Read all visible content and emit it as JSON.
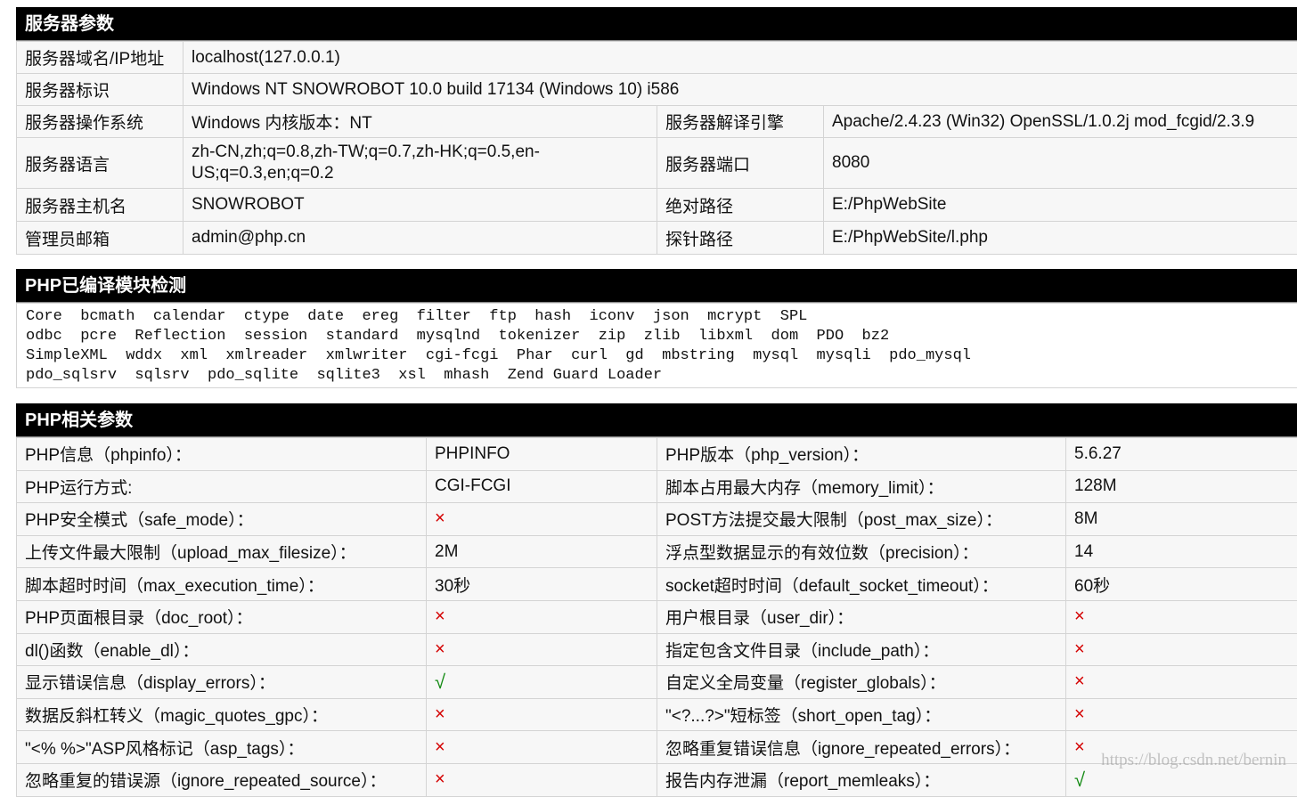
{
  "server_section": {
    "title": "服务器参数",
    "rows": [
      {
        "l1": "服务器域名/IP地址",
        "v1": "localhost(127.0.0.1)"
      },
      {
        "l1": "服务器标识",
        "v1": "Windows NT SNOWROBOT 10.0 build 17134 (Windows 10) i586"
      },
      {
        "l1": "服务器操作系统",
        "v1": "Windows  内核版本：NT",
        "l2": "服务器解译引擎",
        "v2": "Apache/2.4.23 (Win32) OpenSSL/1.0.2j mod_fcgid/2.3.9"
      },
      {
        "l1": "服务器语言",
        "v1": "zh-CN,zh;q=0.8,zh-TW;q=0.7,zh-HK;q=0.5,en-US;q=0.3,en;q=0.2",
        "l2": "服务器端口",
        "v2": "8080"
      },
      {
        "l1": "服务器主机名",
        "v1": "SNOWROBOT",
        "l2": "绝对路径",
        "v2": "E:/PhpWebSite"
      },
      {
        "l1": "管理员邮箱",
        "v1": "admin@php.cn",
        "l2": "探针路径",
        "v2": "E:/PhpWebSite/l.php"
      }
    ]
  },
  "modules_section": {
    "title": "PHP已编译模块检测",
    "lines": [
      "Core  bcmath  calendar  ctype  date  ereg  filter  ftp  hash  iconv  json  mcrypt  SPL",
      "odbc  pcre  Reflection  session  standard  mysqlnd  tokenizer  zip  zlib  libxml  dom  PDO  bz2",
      "SimpleXML  wddx  xml  xmlreader  xmlwriter  cgi-fcgi  Phar  curl  gd  mbstring  mysql  mysqli  pdo_mysql",
      "pdo_sqlsrv  sqlsrv  pdo_sqlite  sqlite3  xsl  mhash  Zend Guard Loader"
    ]
  },
  "php_section": {
    "title": "PHP相关参数",
    "rows": [
      {
        "l1": "PHP信息（phpinfo）：",
        "v1": "PHPINFO",
        "l2": "PHP版本（php_version）：",
        "v2": "5.6.27"
      },
      {
        "l1": "PHP运行方式:",
        "v1": "CGI-FCGI",
        "l2": "脚本占用最大内存（memory_limit）：",
        "v2": "128M"
      },
      {
        "l1": "PHP安全模式（safe_mode）：",
        "v1": "×",
        "l2": "POST方法提交最大限制（post_max_size）：",
        "v2": "8M"
      },
      {
        "l1": "上传文件最大限制（upload_max_filesize）：",
        "v1": "2M",
        "l2": "浮点型数据显示的有效位数（precision）：",
        "v2": "14"
      },
      {
        "l1": "脚本超时时间（max_execution_time）：",
        "v1": "30秒",
        "l2": "socket超时时间（default_socket_timeout）：",
        "v2": "60秒"
      },
      {
        "l1": "PHP页面根目录（doc_root）：",
        "v1": "×",
        "l2": "用户根目录（user_dir）：",
        "v2": "×"
      },
      {
        "l1": "dl()函数（enable_dl）：",
        "v1": "×",
        "l2": "指定包含文件目录（include_path）：",
        "v2": "×"
      },
      {
        "l1": "显示错误信息（display_errors）：",
        "v1": "√",
        "l2": "自定义全局变量（register_globals）：",
        "v2": "×"
      },
      {
        "l1": "数据反斜杠转义（magic_quotes_gpc）：",
        "v1": "×",
        "l2": "\"<?...?>\"短标签（short_open_tag）：",
        "v2": "×"
      },
      {
        "l1": "\"<% %>\"ASP风格标记（asp_tags）：",
        "v1": "×",
        "l2": "忽略重复错误信息（ignore_repeated_errors）：",
        "v2": "×"
      },
      {
        "l1": "忽略重复的错误源（ignore_repeated_source）：",
        "v1": "×",
        "l2": "报告内存泄漏（report_memleaks）：",
        "v2": "√"
      }
    ]
  },
  "watermark": "https://blog.csdn.net/bernin",
  "colors": {
    "header_bg": "#000000",
    "cross": "#d40000",
    "check": "#128a12"
  }
}
